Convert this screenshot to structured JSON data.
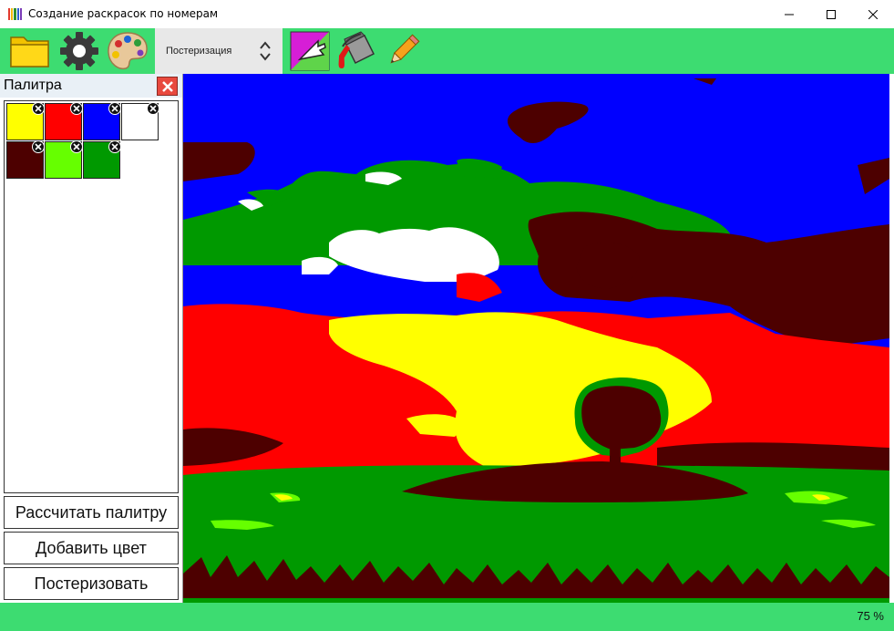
{
  "window": {
    "title": "Создание раскрасок по номерам"
  },
  "app_icon": {
    "icon": "colored-pencils-icon",
    "colors": [
      "#e23a2e",
      "#f2b90a",
      "#2f8f2f",
      "#2d5fd3",
      "#7a3bb8"
    ]
  },
  "toolbar": {
    "buttons": [
      {
        "name": "open-folder-button",
        "icon": "folder-icon"
      },
      {
        "name": "settings-button",
        "icon": "gear-icon"
      },
      {
        "name": "palette-button",
        "icon": "artist-palette-icon"
      },
      {
        "name": "select-tool-button",
        "icon": "cursor-arrow-icon"
      },
      {
        "name": "fill-tool-button",
        "icon": "paint-bucket-icon"
      },
      {
        "name": "pencil-tool-button",
        "icon": "pencil-icon"
      }
    ],
    "mode_select": {
      "value": "Постеризация",
      "icon": "updown-chevron-icon"
    }
  },
  "palette_panel": {
    "title": "Палитра",
    "close_icon": "close-icon",
    "swatches": [
      {
        "color": "#ffff00"
      },
      {
        "color": "#ff0000"
      },
      {
        "color": "#0000ff"
      },
      {
        "color": "#ffffff"
      },
      {
        "color": "#4d0000"
      },
      {
        "color": "#66ff00"
      },
      {
        "color": "#009900"
      }
    ],
    "buttons": {
      "calculate": "Рассчитать палитру",
      "add_color": "Добавить цвет",
      "posterize": "Постеризовать"
    }
  },
  "status": {
    "zoom": "75 %"
  },
  "colors": {
    "accent_green": "#3ddc71",
    "poster_blue": "#0000ff",
    "poster_red": "#ff0000",
    "poster_yellow": "#ffff00",
    "poster_white": "#ffffff",
    "poster_maroon": "#4d0000",
    "poster_green": "#009900",
    "poster_lime": "#66ff00"
  }
}
